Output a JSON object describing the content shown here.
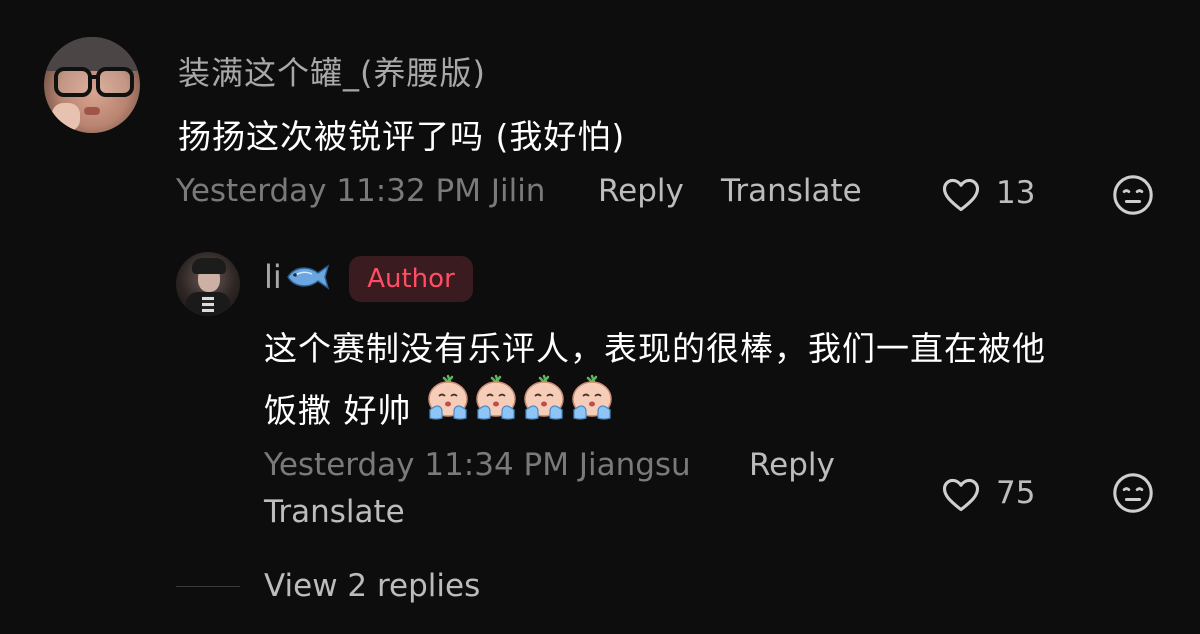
{
  "comment": {
    "username": "装满这个罐_(养腰版)",
    "text": "扬扬这次被锐评了吗 (我好怕)",
    "timestamp_location": "Yesterday 11:32 PM Jilin",
    "reply_label": "Reply",
    "translate_label": "Translate",
    "likes": "13",
    "icons": {
      "like": "heart-icon",
      "dislike": "dislike-face-icon"
    },
    "reply": {
      "username": "li",
      "username_emoji": "fish-emoji",
      "badge": "Author",
      "badge_color": "#ff4d64",
      "text_line1": "这个赛制没有乐评人，表现的很棒，我们一直在被他",
      "text_line2": "饭撒 好帅",
      "emoji_count_label": "crying-emoji x4",
      "timestamp_location": "Yesterday 11:34 PM Jiangsu",
      "reply_label": "Reply",
      "translate_label": "Translate",
      "likes": "75"
    },
    "view_replies_label": "View 2 replies"
  },
  "colors": {
    "background": "#0d0d0d",
    "primary_text": "#ffffff",
    "secondary_text": "#a8a8a8",
    "meta_text": "#7a7a7a",
    "action_text": "#bcbcbc",
    "author_badge_bg": "#3a1c20"
  }
}
